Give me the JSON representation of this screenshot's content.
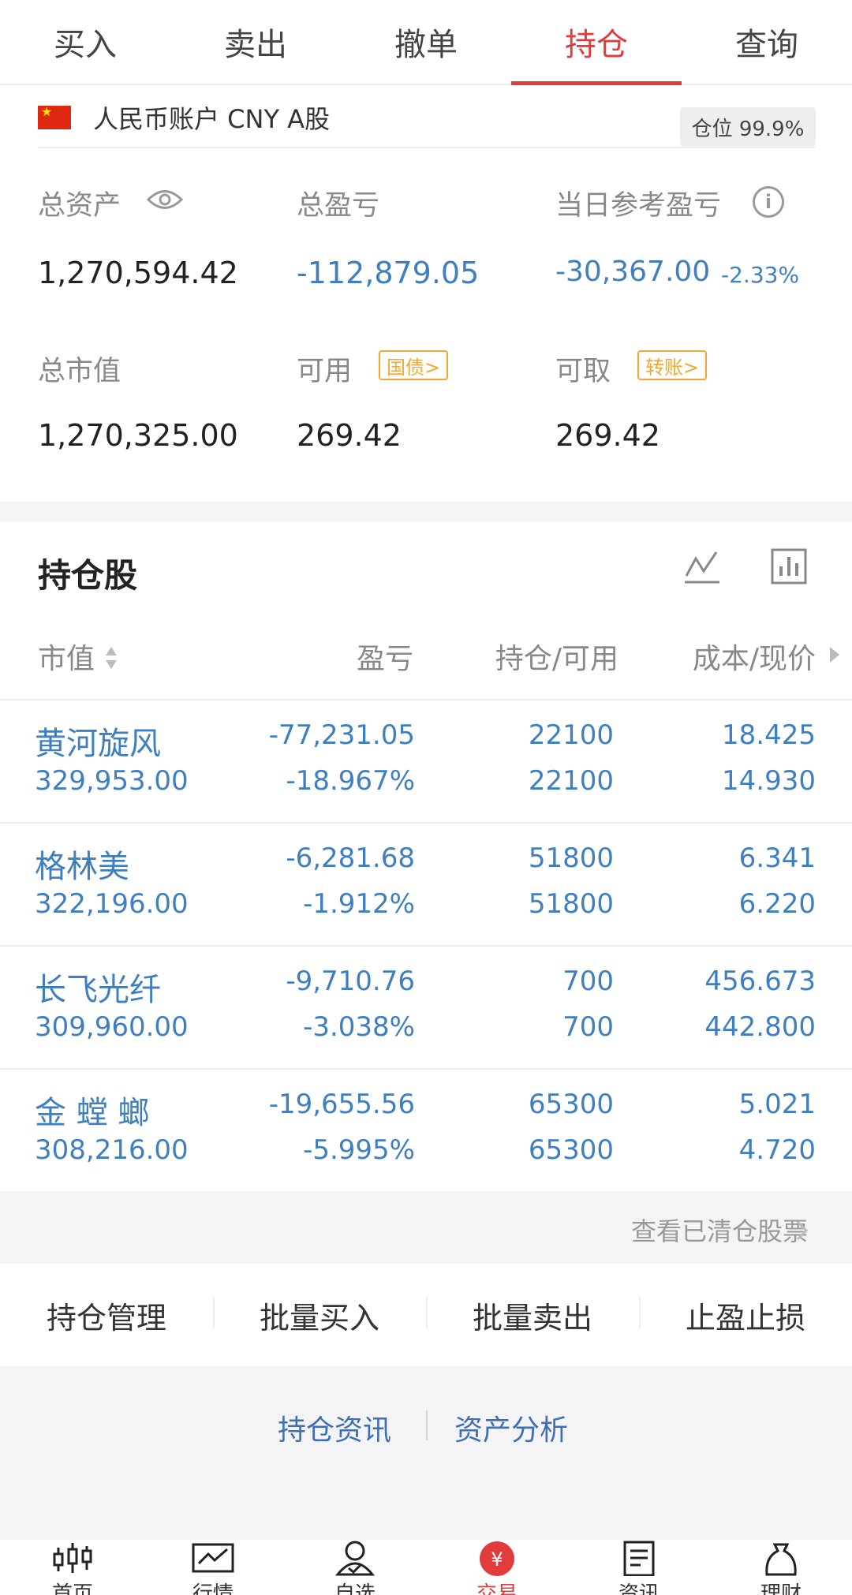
{
  "tabs": [
    {
      "label": "买入",
      "active": false
    },
    {
      "label": "卖出",
      "active": false
    },
    {
      "label": "撤单",
      "active": false
    },
    {
      "label": "持仓",
      "active": true
    },
    {
      "label": "查询",
      "active": false
    }
  ],
  "account": {
    "name": "人民币账户 CNY A股",
    "position_badge": "仓位 99.9%"
  },
  "summary": {
    "total_assets_label": "总资产",
    "total_assets": "1,270,594.42",
    "total_pnl_label": "总盈亏",
    "total_pnl": "-112,879.05",
    "daily_pnl_label": "当日参考盈亏",
    "daily_pnl": "-30,367.00",
    "daily_pnl_pct": "-2.33%",
    "market_value_label": "总市值",
    "market_value": "1,270,325.00",
    "available_label": "可用",
    "available_tag": "国债>",
    "available": "269.42",
    "withdrawable_label": "可取",
    "withdrawable_tag": "转账>",
    "withdrawable": "269.42"
  },
  "holdings": {
    "title": "持仓股",
    "columns": [
      "市值",
      "盈亏",
      "持仓/可用",
      "成本/现价"
    ],
    "rows": [
      {
        "name": "黄河旋风",
        "market_value": "329,953.00",
        "pnl": "-77,231.05",
        "pnl_pct": "-18.967%",
        "position": "22100",
        "available": "22100",
        "cost": "18.425",
        "price": "14.930"
      },
      {
        "name": "格林美",
        "market_value": "322,196.00",
        "pnl": "-6,281.68",
        "pnl_pct": "-1.912%",
        "position": "51800",
        "available": "51800",
        "cost": "6.341",
        "price": "6.220"
      },
      {
        "name": "长飞光纤",
        "market_value": "309,960.00",
        "pnl": "-9,710.76",
        "pnl_pct": "-3.038%",
        "position": "700",
        "available": "700",
        "cost": "456.673",
        "price": "442.800"
      },
      {
        "name": "金 螳 螂",
        "market_value": "308,216.00",
        "pnl": "-19,655.56",
        "pnl_pct": "-5.995%",
        "position": "65300",
        "available": "65300",
        "cost": "5.021",
        "price": "4.720"
      }
    ],
    "cleared_link": "查看已清仓股票"
  },
  "actions": [
    "持仓管理",
    "批量买入",
    "批量卖出",
    "止盈止损"
  ],
  "links": [
    "持仓资讯",
    "资产分析"
  ],
  "bottom_nav": [
    {
      "label": "首页",
      "icon": "candlestick-icon"
    },
    {
      "label": "行情",
      "icon": "market-chart-icon"
    },
    {
      "label": "自选",
      "icon": "user-check-icon"
    },
    {
      "label": "交易",
      "icon": "yuan-circle-icon",
      "active": true
    },
    {
      "label": "资讯",
      "icon": "document-icon"
    },
    {
      "label": "理财",
      "icon": "money-bag-icon"
    }
  ],
  "colors": {
    "accent_red": "#e03c3c",
    "loss_blue": "#3f7fbf",
    "tag_orange": "#f0a830"
  }
}
